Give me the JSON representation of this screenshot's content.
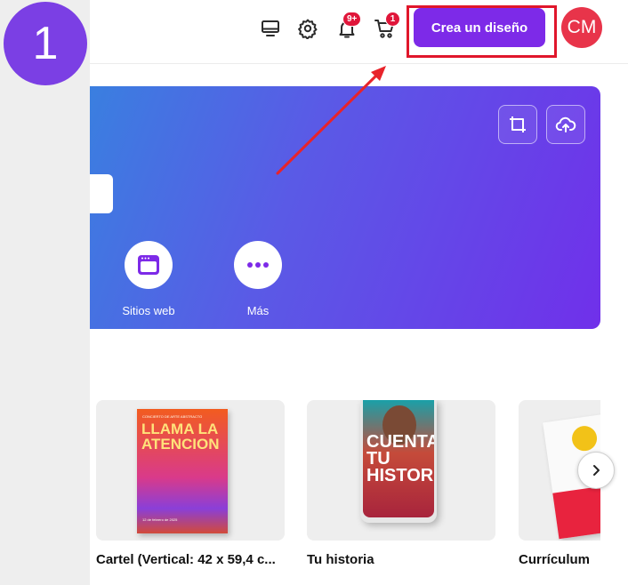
{
  "step": {
    "number": "1"
  },
  "topbar": {
    "notifications_badge": "9+",
    "cart_badge": "1",
    "create_button_label": "Crea un diseño",
    "avatar_initials": "CM",
    "icons": [
      "desktop-icon",
      "gear-icon",
      "bell-icon",
      "cart-icon"
    ]
  },
  "hero": {
    "categories": [
      {
        "label": "Sitios web",
        "icon": "website-icon"
      },
      {
        "label": "Más",
        "icon": "more-icon"
      }
    ],
    "buttons": [
      "resize-icon",
      "cloud-upload-icon"
    ]
  },
  "templates": {
    "items": [
      {
        "label": "Cartel (Vertical: 42 x 59,4 c...",
        "thumb": {
          "small_top": "CONCIERTO DE ARTE ABSTRACTO",
          "big": "LLAMA LA ATENCION",
          "small_bottom": "12 de febrero de 2025"
        }
      },
      {
        "label": "Tu historia",
        "thumb": {
          "big": "CUENTA TU HISTORIA"
        }
      },
      {
        "label": "Currículum",
        "thumb": {}
      }
    ]
  },
  "colors": {
    "accent": "#7d2ae8",
    "highlight": "#e0162b",
    "avatar": "#e8344a",
    "badge": "#e0163a",
    "step_badge": "#7b3fe4"
  }
}
